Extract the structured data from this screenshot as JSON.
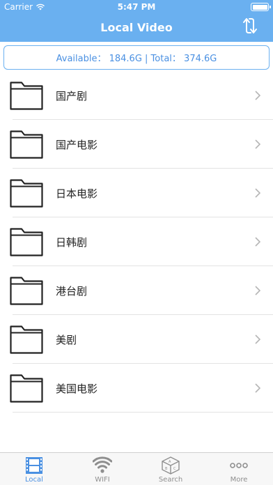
{
  "status_bar": {
    "carrier": "Carrier",
    "time": "5:47 PM"
  },
  "header": {
    "title": "Local Video",
    "refresh_icon": "refresh-icon",
    "bg_color": "#6ab0f0"
  },
  "storage": {
    "text": "Available： 184.6G | Total： 374.6G"
  },
  "folders": [
    {
      "label": "国产剧"
    },
    {
      "label": "国产电影"
    },
    {
      "label": "日本电影"
    },
    {
      "label": "日韩剧"
    },
    {
      "label": "港台剧"
    },
    {
      "label": "美剧"
    },
    {
      "label": "美国电影"
    }
  ],
  "tabbar": {
    "tabs": [
      {
        "label": "Local",
        "icon": "film-icon",
        "active": true
      },
      {
        "label": "WIFI",
        "icon": "wifi-icon",
        "active": false
      },
      {
        "label": "Search",
        "icon": "search-cube-icon",
        "active": false
      },
      {
        "label": "More",
        "icon": "more-dots-icon",
        "active": false
      }
    ],
    "active_color": "#4a90e2"
  }
}
